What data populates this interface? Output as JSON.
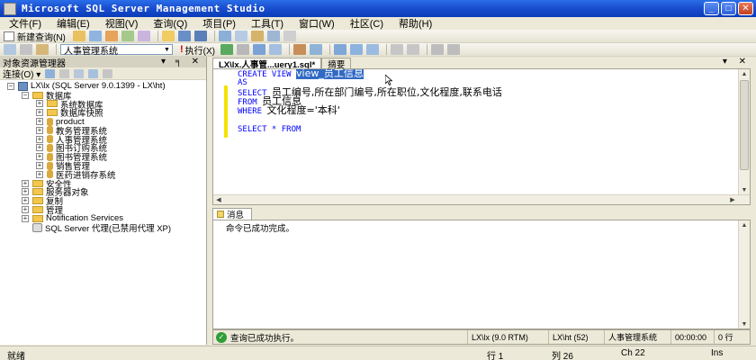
{
  "window": {
    "title": "Microsoft SQL Server Management Studio"
  },
  "menu": [
    "文件(F)",
    "编辑(E)",
    "视图(V)",
    "查询(Q)",
    "项目(P)",
    "工具(T)",
    "窗口(W)",
    "社区(C)",
    "帮助(H)"
  ],
  "toolbar": {
    "new_query": "新建查询(N)",
    "database": "人事管理系统",
    "execute": "执行(X)"
  },
  "object_explorer": {
    "title": "对象资源管理器",
    "connect": "连接(O) ▾",
    "tree": {
      "server": "LX\\lx (SQL Server 9.0.1399 - LX\\ht)",
      "databases": "数据库",
      "db_items": [
        "系统数据库",
        "数据库快照",
        "product",
        "教务管理系统",
        "人事管理系统",
        "图书订购系统",
        "图书管理系统",
        "销售管理",
        "医药进销存系统"
      ],
      "server_items": [
        "安全性",
        "服务器对象",
        "复制",
        "管理",
        "Notification Services"
      ],
      "agent": "SQL Server 代理(已禁用代理 XP)"
    }
  },
  "editor": {
    "tab_active": "LX\\lx.人事管...uery1.sql*",
    "tab_inactive": "摘要",
    "lines": {
      "l1_kw": "CREATE VIEW ",
      "l1_sel": "view_员工信息",
      "l2_kw": "AS",
      "l3_kw": "SELECT ",
      "l3_text": "员工编号,所在部门编号,所在职位,文化程度,联系电话",
      "l4_kw": "FROM ",
      "l4_text": "员工信息",
      "l5_kw": "WHERE ",
      "l5_text": "文化程度=",
      "l5_str": "'本科'",
      "l6_kw": "SELECT * FROM"
    }
  },
  "results": {
    "tab": "消息",
    "message": "命令已成功完成。"
  },
  "query_status": {
    "message": "查询已成功执行。",
    "server": "LX\\lx (9.0 RTM)",
    "user": "LX\\ht (52)",
    "database": "人事管理系统",
    "elapsed": "00:00:00",
    "rows": "0 行"
  },
  "statusbar": {
    "ready": "就绪",
    "line": "行 1",
    "col": "列 26",
    "ch": "Ch 22",
    "mode": "Ins"
  }
}
